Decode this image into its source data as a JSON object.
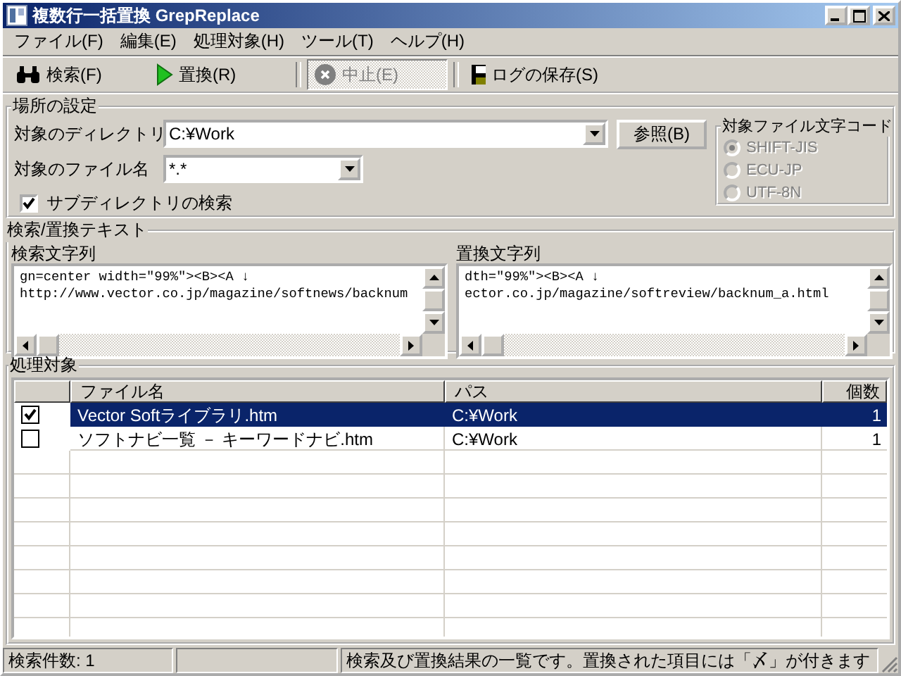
{
  "window": {
    "title": "複数行一括置換 GrepReplace"
  },
  "menu": [
    "ファイル(F)",
    "編集(E)",
    "処理対象(H)",
    "ツール(T)",
    "ヘルプ(H)"
  ],
  "toolbar": [
    {
      "label": "検索(F)",
      "kind": "search",
      "disabled": false
    },
    {
      "label": "置換(R)",
      "kind": "replace",
      "disabled": false
    },
    {
      "label": "中止(E)",
      "kind": "stop",
      "disabled": true
    },
    {
      "label": "ログの保存(S)",
      "kind": "save",
      "disabled": false
    }
  ],
  "location": {
    "title": "場所の設定",
    "directory_label": "対象のディレクトリ",
    "directory": "C:¥Work",
    "filename_label": "対象のファイル名",
    "filename": "*.*",
    "browse_button": "参照(B)",
    "subdir": {
      "label": "サブディレクトリの検索",
      "checked": true
    }
  },
  "encoding": {
    "title": "対象ファイル文字コード",
    "disabled": true,
    "options": [
      {
        "label": "SHIFT-JIS",
        "selected": true
      },
      {
        "label": "ECU-JP",
        "selected": false
      },
      {
        "label": "UTF-8N",
        "selected": false
      }
    ]
  },
  "text": {
    "title": "検索/置換テキスト",
    "panes": [
      {
        "label": "検索文字列",
        "lines": [
          "gn=center width=\"99%\"><B><A ↓",
          "http://www.vector.co.jp/magazine/softnews/backnum"
        ]
      },
      {
        "label": "置換文字列",
        "lines": [
          "dth=\"99%\"><B><A ↓",
          "ector.co.jp/magazine/softreview/backnum_a.html"
        ]
      }
    ]
  },
  "targets": {
    "title": "処理対象",
    "columns": [
      "ファイル名",
      "パス",
      "個数"
    ],
    "rows": [
      {
        "checked": true,
        "selected": true,
        "file": "Vector Softライブラリ.htm",
        "path": "C:¥Work",
        "count": "1"
      },
      {
        "checked": false,
        "selected": false,
        "file": "ソフトナビ一覧 － キーワードナビ.htm",
        "path": "C:¥Work",
        "count": "1"
      }
    ]
  },
  "status_bar": {
    "count": "検索件数: 1",
    "message": "検索及び置換結果の一覧です。置換された項目には「〆」が付きます"
  }
}
